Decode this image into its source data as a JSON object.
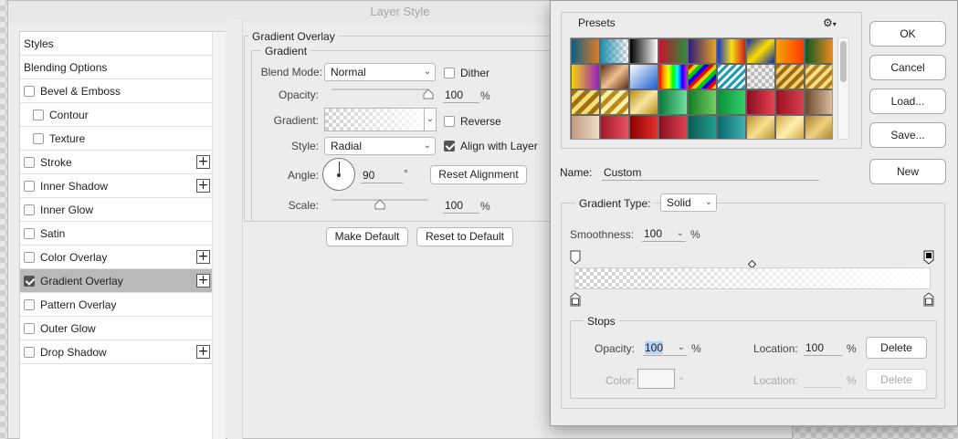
{
  "layer_style": {
    "title": "Layer Style",
    "styles_list": [
      {
        "label": "Styles",
        "checkbox": false,
        "checked": false,
        "plus": false,
        "indent": 0,
        "selected": false
      },
      {
        "label": "Blending Options",
        "checkbox": false,
        "checked": false,
        "plus": false,
        "indent": 0,
        "selected": false
      },
      {
        "label": "Bevel & Emboss",
        "checkbox": true,
        "checked": false,
        "plus": false,
        "indent": 0,
        "selected": false
      },
      {
        "label": "Contour",
        "checkbox": true,
        "checked": false,
        "plus": false,
        "indent": 1,
        "selected": false
      },
      {
        "label": "Texture",
        "checkbox": true,
        "checked": false,
        "plus": false,
        "indent": 1,
        "selected": false
      },
      {
        "label": "Stroke",
        "checkbox": true,
        "checked": false,
        "plus": true,
        "indent": 0,
        "selected": false
      },
      {
        "label": "Inner Shadow",
        "checkbox": true,
        "checked": false,
        "plus": true,
        "indent": 0,
        "selected": false
      },
      {
        "label": "Inner Glow",
        "checkbox": true,
        "checked": false,
        "plus": false,
        "indent": 0,
        "selected": false
      },
      {
        "label": "Satin",
        "checkbox": true,
        "checked": false,
        "plus": false,
        "indent": 0,
        "selected": false
      },
      {
        "label": "Color Overlay",
        "checkbox": true,
        "checked": false,
        "plus": true,
        "indent": 0,
        "selected": false
      },
      {
        "label": "Gradient Overlay",
        "checkbox": true,
        "checked": true,
        "plus": true,
        "indent": 0,
        "selected": true
      },
      {
        "label": "Pattern Overlay",
        "checkbox": true,
        "checked": false,
        "plus": false,
        "indent": 0,
        "selected": false
      },
      {
        "label": "Outer Glow",
        "checkbox": true,
        "checked": false,
        "plus": false,
        "indent": 0,
        "selected": false
      },
      {
        "label": "Drop Shadow",
        "checkbox": true,
        "checked": false,
        "plus": true,
        "indent": 0,
        "selected": false
      }
    ],
    "overlay": {
      "section_title": "Gradient Overlay",
      "group_title": "Gradient",
      "blend_mode_label": "Blend Mode:",
      "blend_mode_value": "Normal",
      "dither_label": "Dither",
      "dither_checked": false,
      "opacity_label": "Opacity:",
      "opacity_value": "100",
      "opacity_unit": "%",
      "opacity_level": 1.0,
      "gradient_label": "Gradient:",
      "reverse_label": "Reverse",
      "reverse_checked": false,
      "style_label": "Style:",
      "style_value": "Radial",
      "align_label": "Align with Layer",
      "align_checked": true,
      "angle_label": "Angle:",
      "angle_value": "90",
      "angle_unit": "°",
      "reset_alignment_label": "Reset Alignment",
      "scale_label": "Scale:",
      "scale_value": "100",
      "scale_unit": "%",
      "scale_level": 0.5,
      "make_default_label": "Make Default",
      "reset_default_label": "Reset to Default"
    }
  },
  "gradient_editor": {
    "presets_label": "Presets",
    "gear_icon": "gear-icon",
    "swatches": [
      [
        "#1e6b77",
        "#1f7f86",
        "#000000",
        "#c8102e",
        "#2a1d7a",
        "#1734c7",
        "#1a3ad0",
        "#f2a40a",
        "#2a8f3a"
      ],
      [
        "#f5d40b",
        "#7a3f2a",
        "#2a6fd8",
        "#ff0000",
        "#2aa6a6",
        "#cccccc",
        "#c89a2e",
        "#b8860b",
        "#d6b25a"
      ],
      [
        "#c8960e",
        "#e0b030",
        "#d8a820",
        "#19a05a",
        "#2fae45",
        "#1fb24a",
        "#d21f2f",
        "#c02030",
        "#a07a5a"
      ],
      [
        "#d9b7a0",
        "#c83040",
        "#c01818",
        "#c02038",
        "#138070",
        "#1a8f8a",
        "#d8b448",
        "#e8c860",
        "#c8a450"
      ]
    ],
    "swatch_backgrounds": [
      [
        "linear-gradient(90deg,#0f5f86,#e07a20)",
        "linear-gradient(90deg,#1f8fb0,#cfcfcf)",
        "linear-gradient(90deg,#000,#fff)",
        "linear-gradient(90deg,#c8102e,#2a8f3a)",
        "linear-gradient(90deg,#2a1d7a,#e8a020)",
        "linear-gradient(90deg,#1734c7,#f5e012,#d41c1c)",
        "linear-gradient(135deg,#0a2aa8,#ffdd00,#0a2aa8)",
        "linear-gradient(90deg,#f2a40a,#ff3a00)",
        "linear-gradient(90deg,#0c5a1f,#ef8a20)"
      ],
      [
        "linear-gradient(90deg,#f5d40b,#9b1fbf)",
        "linear-gradient(135deg,#5b2b1a,#f0c090,#5b2b1a)",
        "linear-gradient(135deg,#ffffff,#1a5fd0)",
        "linear-gradient(90deg,red,orange,yellow,lime,cyan,blue,magenta)",
        "repeating-linear-gradient(135deg,#e00 0 4px,#fc0 4px 8px,#0c0 8px 12px,#00f 12px 16px)",
        "repeating-linear-gradient(135deg,#1a9fb0 0 3px,#fff 3px 6px)",
        "repeating-linear-gradient(135deg,#bbb 0 4px,#eee 4px 8px)",
        "repeating-linear-gradient(135deg,#9a6a10 0 4px,#f0d070 4px 8px)",
        "repeating-linear-gradient(135deg,#b08020 0 4px,#f6e08a 4px 8px)"
      ],
      [
        "repeating-linear-gradient(135deg,#a07010 0 5px,#f7dd7a 5px 10px)",
        "repeating-linear-gradient(135deg,#b88a20 0 5px,#fff0a0 5px 10px)",
        "linear-gradient(135deg,#b88a1a,#f8e6a0,#b88a1a)",
        "linear-gradient(90deg,#0a7a3a,#6ee0a0)",
        "linear-gradient(90deg,#157a25,#70d060)",
        "linear-gradient(90deg,#0b8f3a,#31d06a)",
        "linear-gradient(90deg,#8a0f1f,#e84050)",
        "linear-gradient(90deg,#9a1020,#d84050)",
        "linear-gradient(90deg,#6a4a2a,#e0c0a0)"
      ],
      [
        "linear-gradient(90deg,#c09a80,#f0dcc8)",
        "linear-gradient(90deg,#a01a2a,#e85060)",
        "linear-gradient(90deg,#8a0000,#e83030)",
        "linear-gradient(90deg,#8a1020,#e04050)",
        "linear-gradient(90deg,#0a5a50,#20a090)",
        "linear-gradient(90deg,#0a6a70,#40b0b0)",
        "linear-gradient(135deg,#b89030,#f8e090,#b89030)",
        "linear-gradient(135deg,#d0a840,#fff0b0,#d0a840)",
        "linear-gradient(135deg,#a88030,#f0d080,#a88030)"
      ]
    ],
    "buttons": {
      "ok": "OK",
      "cancel": "Cancel",
      "load": "Load...",
      "save": "Save...",
      "new": "New"
    },
    "name_label": "Name:",
    "name_value": "Custom",
    "gradient_type_label": "Gradient Type:",
    "gradient_type_value": "Solid",
    "smoothness_label": "Smoothness:",
    "smoothness_value": "100",
    "smoothness_unit": "%",
    "stops": {
      "group_title": "Stops",
      "opacity_label": "Opacity:",
      "opacity_value": "100",
      "opacity_unit": "%",
      "location_label": "Location:",
      "location_value": "100",
      "location_unit": "%",
      "delete_label": "Delete",
      "color_label": "Color:",
      "color_location_label": "Location:",
      "color_location_unit": "%",
      "color_delete_label": "Delete"
    }
  }
}
